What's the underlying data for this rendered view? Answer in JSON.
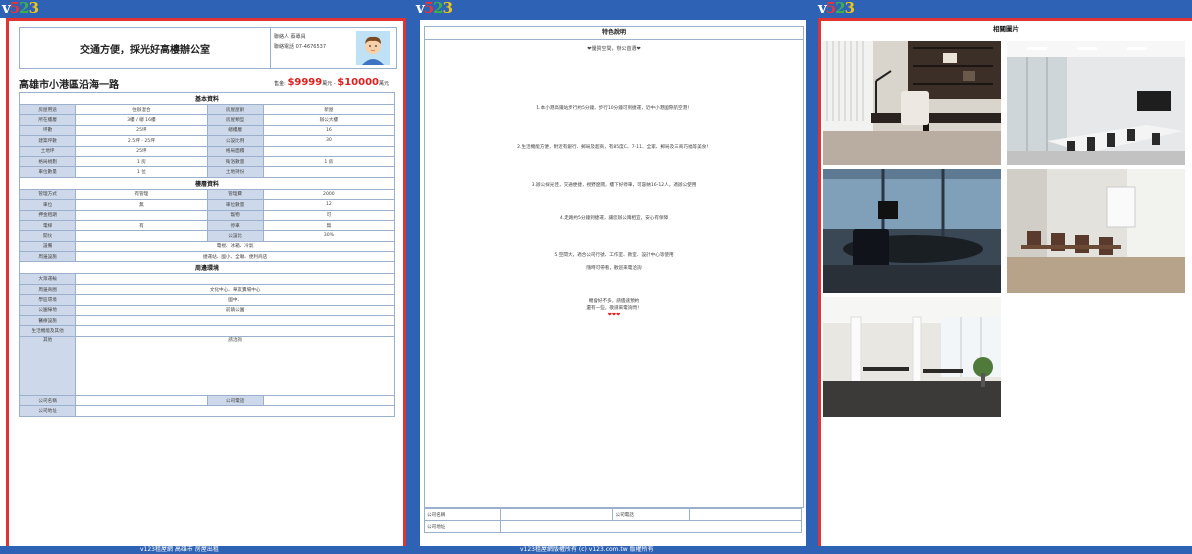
{
  "logo": {
    "v": "v",
    "n5": "5",
    "n2": "2",
    "n3": "3"
  },
  "sheet1": {
    "header_title": "交通方便，採光好高樓辦公室",
    "agent_line1": "聯絡人 蔡專員",
    "agent_line2": "聯絡電話 07-4676537",
    "address": "高雄市小港區沿海一路",
    "price_label": "售金:",
    "price_from": "$9999",
    "price_unit1": "萬元 -",
    "price_to": "$10000",
    "price_unit2": "萬元",
    "sec_basic": "基本資料",
    "basic": [
      [
        "房屋用途",
        "住辦混合",
        "房屋屋齡",
        "新屋"
      ],
      [
        "所在樓層",
        "3樓 / 總 16樓",
        "房屋類型",
        "辦公大樓"
      ],
      [
        "坪數",
        "25坪",
        "總樓層",
        "16"
      ],
      [
        "建築坪數",
        "2.5坪 - 25坪",
        "公設比例",
        "30"
      ],
      [
        "土地坪",
        "25坪",
        "格局面積",
        ""
      ],
      [
        "格局規劃",
        "1 房",
        "衛浴數量",
        "1 房"
      ],
      [
        "車位數量",
        "1 位",
        "土地持份",
        ""
      ]
    ],
    "sec_rent": "樓層資料",
    "rent": [
      [
        "管理方式",
        "有管理",
        "管理費",
        "2000"
      ],
      [
        "車位",
        "無",
        "車位數量",
        "12"
      ],
      [
        "押金租期",
        "",
        "寵物",
        "可"
      ],
      [
        "電梯",
        "有",
        "停車",
        "無"
      ],
      [
        "開伙",
        "",
        "公設比",
        "30%"
      ]
    ],
    "rent_wide": [
      [
        "設備",
        "電視、冰箱、冷氣"
      ],
      [
        "周邊設施",
        "捷運站、國小、全聯、便利商店"
      ]
    ],
    "sec_env": "周邊環境",
    "env": [
      [
        "大眾運輸",
        ""
      ],
      [
        "周邊商圈",
        "文化中心、華友賣場中心"
      ],
      [
        "學區環境",
        "國中、"
      ],
      [
        "公園綠地",
        "前鎮公園"
      ],
      [
        "醫療設施",
        ""
      ],
      [
        "生活機能及其他",
        ""
      ],
      [
        "其他",
        "請洽詢"
      ]
    ],
    "footer": [
      [
        "公司名稱",
        "",
        "公司電話",
        ""
      ],
      [
        "公司地址",
        "",
        "",
        ""
      ]
    ]
  },
  "sheet2": {
    "title": "特色說明",
    "slogan": "❤優質空間，辦公首選❤",
    "features": [
      "1.本小港高鐵站步行約5分鐘，步行10分鐘可到捷運，近中小港國際航空港！",
      "2.生活機能方便，附近有銀行、郵局及超商，有85度C、7-11、全家、郵局及三商巧福等美食！",
      "3.辦公採光佳，交通便捷，視野遼闊，樓下好停車，可容納16-12人，適辦公使用",
      "4.走路約5分鐘到捷運，讓您辦公兩相宜，安心有保障",
      "5.空間大，適合公司行號、工作室、教室、設計中心等使用",
      "隨時可帶看，歡迎來電洽詢"
    ],
    "closing1": "機會好不多，請儘速預約",
    "closing2": "還有一些，敬請來電詢問！",
    "hearts": "❤❤❤",
    "contact": [
      [
        "公司名稱",
        "",
        "公司電話",
        ""
      ],
      [
        "公司地址",
        "",
        "",
        ""
      ]
    ]
  },
  "sheet3": {
    "title": "相關圖片"
  },
  "bottom": {
    "left": "v123租屋網 高雄市 房屋出租",
    "mid": "v123租屋網版權所有 (c) v123.com.tw 版權所有"
  },
  "colors": {
    "blue": "#2d62b4",
    "red": "#e03434",
    "label_bg": "#cdd9ea",
    "price": "#e01e1e"
  }
}
